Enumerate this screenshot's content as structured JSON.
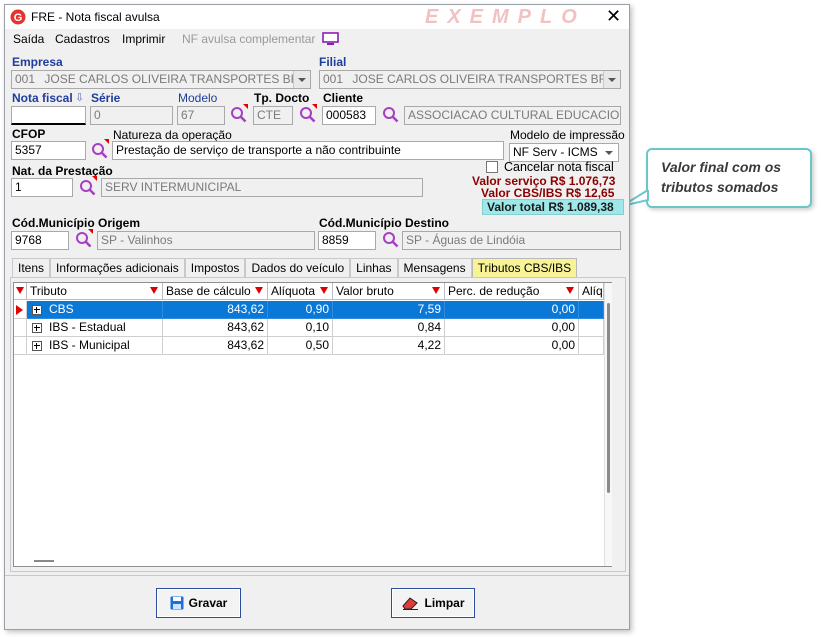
{
  "window": {
    "title": "FRE - Nota fiscal avulsa",
    "watermark": "EXEMPLO"
  },
  "menu": {
    "items": [
      "Saída",
      "Cadastros",
      "Imprimir",
      "NF avulsa complementar"
    ]
  },
  "form": {
    "empresa": {
      "label": "Empresa",
      "code": "001",
      "name": "JOSE CARLOS OLIVEIRA TRANSPORTES BRASIL L"
    },
    "filial": {
      "label": "Filial",
      "code": "001",
      "name": "JOSE CARLOS OLIVEIRA TRANSPORTES BRASIL L"
    },
    "nota_fiscal": {
      "label": "Nota fiscal",
      "value": ""
    },
    "serie": {
      "label": "Série",
      "value": "0"
    },
    "modelo": {
      "label": "Modelo",
      "value": "67"
    },
    "tp_docto": {
      "label": "Tp. Docto",
      "value": "CTE"
    },
    "cliente": {
      "label": "Cliente",
      "code": "000583",
      "name": "ASSOCIACAO CULTURAL EDUCACIONAL"
    },
    "cfop": {
      "label": "CFOP",
      "value": "5357"
    },
    "natureza": {
      "label": "Natureza da operação",
      "value": "Prestação de serviço de transporte a não contribuinte"
    },
    "modelo_impressao": {
      "label": "Modelo de impressão",
      "value": "NF Serv - ICMS"
    },
    "nat_prestacao": {
      "label": "Nat. da Prestação",
      "code": "1",
      "name": "SERV INTERMUNICIPAL"
    },
    "cancelar": {
      "label": "Cancelar nota fiscal"
    },
    "totais": {
      "valor_servico": "Valor serviço R$ 1.076,73",
      "valor_cbs_ibs": "Valor CBS/IBS R$ 12,65",
      "valor_total": "Valor total R$ 1.089,38"
    },
    "mun_origem": {
      "label": "Cód.Município Origem",
      "code": "9768",
      "name": "SP - Valinhos"
    },
    "mun_destino": {
      "label": "Cód.Município Destino",
      "code": "8859",
      "name": "SP - Águas de Lindóia"
    }
  },
  "tabs": [
    "Itens",
    "Informações adicionais",
    "Impostos",
    "Dados do veículo",
    "Linhas",
    "Mensagens",
    "Tributos CBS/IBS"
  ],
  "grid": {
    "columns": [
      "Tributo",
      "Base de cálculo",
      "Alíquota",
      "Valor bruto",
      "Perc. de redução",
      "Alíq."
    ],
    "rows": [
      {
        "tributo": "CBS",
        "base": "843,62",
        "aliquota": "0,90",
        "valor": "7,59",
        "reducao": "0,00"
      },
      {
        "tributo": "IBS - Estadual",
        "base": "843,62",
        "aliquota": "0,10",
        "valor": "0,84",
        "reducao": "0,00"
      },
      {
        "tributo": "IBS - Municipal",
        "base": "843,62",
        "aliquota": "0,50",
        "valor": "4,22",
        "reducao": "0,00"
      }
    ]
  },
  "buttons": {
    "gravar": "Gravar",
    "limpar": "Limpar"
  },
  "callout": {
    "line1": "Valor final com os",
    "line2": "tributos somados"
  },
  "colors": {
    "accent": "#0a78d7",
    "red_total": "#8b0000",
    "highlight": "#9fe8ea",
    "tab_active": "#f7f396"
  }
}
